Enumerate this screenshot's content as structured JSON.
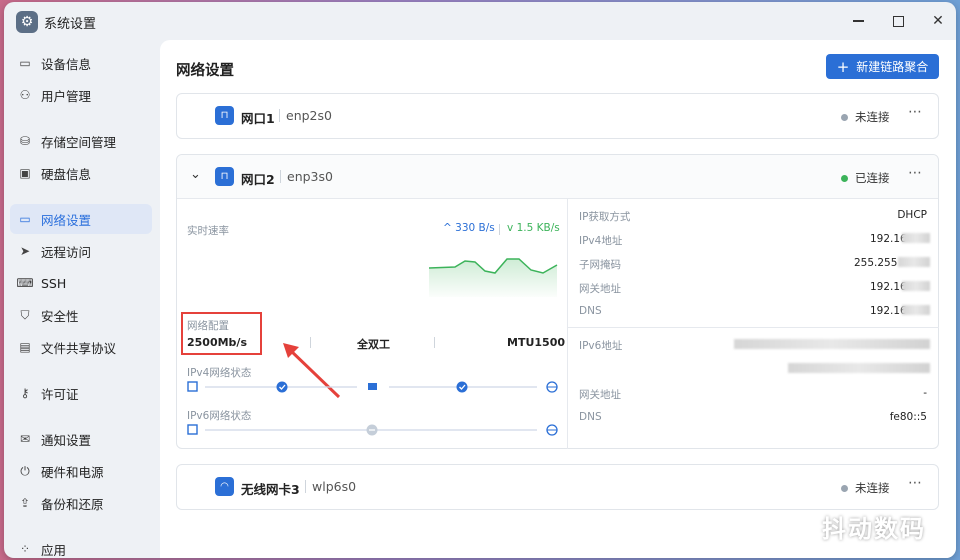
{
  "window": {
    "title": "系统设置"
  },
  "sidebar": {
    "items": [
      {
        "label": "设备信息",
        "icon": "laptop-icon"
      },
      {
        "label": "用户管理",
        "icon": "users-icon"
      },
      {
        "label": "存储空间管理",
        "icon": "storage-icon"
      },
      {
        "label": "硬盘信息",
        "icon": "disk-icon"
      },
      {
        "label": "网络设置",
        "icon": "network-icon",
        "active": true
      },
      {
        "label": "远程访问",
        "icon": "send-icon"
      },
      {
        "label": "SSH",
        "icon": "terminal-icon"
      },
      {
        "label": "安全性",
        "icon": "shield-icon"
      },
      {
        "label": "文件共享协议",
        "icon": "file-share-icon"
      },
      {
        "label": "许可证",
        "icon": "key-icon"
      },
      {
        "label": "通知设置",
        "icon": "mail-icon"
      },
      {
        "label": "硬件和电源",
        "icon": "power-icon"
      },
      {
        "label": "备份和还原",
        "icon": "backup-icon"
      },
      {
        "label": "应用",
        "icon": "apps-icon"
      }
    ]
  },
  "main": {
    "title": "网络设置",
    "new_button": "新建链路聚合",
    "ports": [
      {
        "name": "网口1",
        "device": "enp2s0",
        "status": "未连接",
        "status_color": "#9aa5b1"
      },
      {
        "name": "网口2",
        "device": "enp3s0",
        "status": "已连接",
        "status_color": "#3cb35a"
      },
      {
        "name": "无线网卡3",
        "device": "wlp6s0",
        "status": "未连接",
        "status_color": "#9aa5b1"
      }
    ],
    "detail": {
      "speed_label": "实时速率",
      "upload": "330 B/s",
      "download": "1.5 KB/s",
      "config_label": "网络配置",
      "config_speed": "2500Mb/s",
      "duplex": "全双工",
      "mtu": "MTU1500",
      "ipv4_state_label": "IPv4网络状态",
      "ipv6_state_label": "IPv6网络状态",
      "rows_v4": [
        {
          "label": "IP获取方式",
          "value": "DHCP"
        },
        {
          "label": "IPv4地址",
          "value": "192.16"
        },
        {
          "label": "子网掩码",
          "value": "255.255"
        },
        {
          "label": "网关地址",
          "value": "192.16"
        },
        {
          "label": "DNS",
          "value": "192.16"
        }
      ],
      "rows_v6": [
        {
          "label": "IPv6地址",
          "value": ""
        },
        {
          "label": "网关地址",
          "value": "-"
        },
        {
          "label": "DNS",
          "value": "fe80::5"
        }
      ]
    }
  },
  "watermark": "抖动数码",
  "colors": {
    "accent": "#2b6fd6",
    "upload": "#2b6fd6",
    "download": "#3cb35a",
    "highlight_box": "#e5413b"
  }
}
